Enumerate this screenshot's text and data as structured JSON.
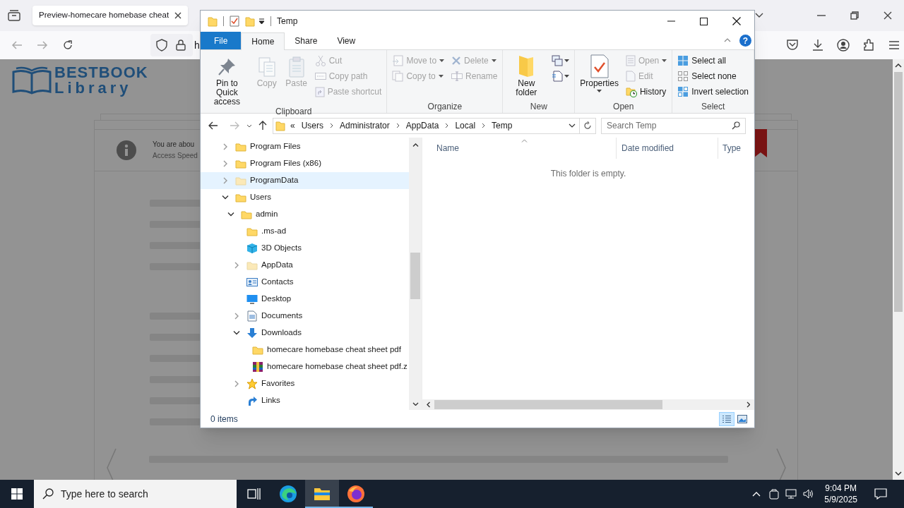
{
  "browser": {
    "tab": {
      "title": "Preview-homecare homebase cheat"
    },
    "url": "h"
  },
  "page": {
    "logo": {
      "line_1": "BESTBOOK",
      "line_2": "Library"
    },
    "notice": {
      "line_1": "You are abou",
      "line_2": "Access Speed"
    }
  },
  "explorer": {
    "title": "Temp",
    "help_label": "?",
    "ribbon_tabs": [
      {
        "label": "File",
        "kind": "file",
        "selected": false
      },
      {
        "label": "Home",
        "kind": "tab",
        "selected": true
      },
      {
        "label": "Share",
        "kind": "tab",
        "selected": false
      },
      {
        "label": "View",
        "kind": "tab",
        "selected": false
      }
    ],
    "ribbon_groups": [
      {
        "label": "Clipboard",
        "columns": [
          [
            {
              "label": "Pin to Quick access",
              "kind": "large",
              "disabled": false
            }
          ],
          [
            {
              "label": "Copy",
              "kind": "large",
              "disabled": true
            }
          ],
          [
            {
              "label": "Paste",
              "kind": "large",
              "disabled": true
            }
          ],
          [
            {
              "label": "Cut",
              "kind": "small",
              "disabled": true
            },
            {
              "label": "Copy path",
              "kind": "small",
              "disabled": true
            },
            {
              "label": "Paste shortcut",
              "kind": "small",
              "disabled": true
            }
          ]
        ]
      },
      {
        "label": "Organize",
        "columns": [
          [
            {
              "label": "Move to",
              "kind": "small",
              "disabled": true,
              "dropdown": true
            },
            {
              "label": "Copy to",
              "kind": "small",
              "disabled": true,
              "dropdown": true
            }
          ],
          [
            {
              "label": "Delete",
              "kind": "small",
              "disabled": true,
              "dropdown": true
            },
            {
              "label": "Rename",
              "kind": "small",
              "disabled": true
            }
          ]
        ]
      },
      {
        "label": "New",
        "columns": [
          [
            {
              "label": "New folder",
              "kind": "large",
              "disabled": false
            }
          ],
          [
            {
              "kind": "icon",
              "disabled": false,
              "dropdown": true
            },
            {
              "kind": "icon",
              "disabled": false,
              "dropdown": true
            }
          ]
        ]
      },
      {
        "label": "Open",
        "columns": [
          [
            {
              "label": "Properties",
              "kind": "large",
              "disabled": false,
              "dropdown": true
            }
          ],
          [
            {
              "label": "Open",
              "kind": "small",
              "disabled": true,
              "dropdown": true
            },
            {
              "label": "Edit",
              "kind": "small",
              "disabled": true
            },
            {
              "label": "History",
              "kind": "small",
              "disabled": false
            }
          ]
        ]
      },
      {
        "label": "Select",
        "columns": [
          [
            {
              "label": "Select all",
              "kind": "small",
              "disabled": false
            },
            {
              "label": "Select none",
              "kind": "small",
              "disabled": false
            },
            {
              "label": "Invert selection",
              "kind": "small",
              "disabled": false
            }
          ]
        ]
      }
    ],
    "address": {
      "overflow": "«",
      "segments": [
        "Users",
        "Administrator",
        "AppData",
        "Local",
        "Temp"
      ]
    },
    "search": {
      "placeholder": "Search Temp"
    },
    "tree": [
      {
        "label": "Program Files",
        "kind": "folder",
        "expanded": false,
        "selected": false
      },
      {
        "label": "Program Files (x86)",
        "kind": "folder",
        "expanded": false,
        "selected": false
      },
      {
        "label": "ProgramData",
        "kind": "hidden-folder",
        "expanded": false,
        "selected": true
      },
      {
        "label": "Users",
        "kind": "folder",
        "expanded": true,
        "selected": false,
        "children": [
          {
            "label": "admin",
            "kind": "folder",
            "expanded": true,
            "selected": false,
            "children": [
              {
                "label": ".ms-ad",
                "kind": "folder",
                "selected": false
              },
              {
                "label": "3D Objects",
                "kind": "objects",
                "selected": false
              },
              {
                "label": "AppData",
                "kind": "hidden-folder",
                "expanded": false,
                "selected": false
              },
              {
                "label": "Contacts",
                "kind": "contacts",
                "selected": false
              },
              {
                "label": "Desktop",
                "kind": "desktop",
                "selected": false
              },
              {
                "label": "Documents",
                "kind": "documents",
                "expanded": false,
                "selected": false
              },
              {
                "label": "Downloads",
                "kind": "downloads",
                "expanded": true,
                "selected": false,
                "children": [
                  {
                    "label": "homecare homebase cheat sheet pdf",
                    "kind": "folder",
                    "selected": false
                  },
                  {
                    "label": "homecare homebase cheat sheet pdf.z",
                    "kind": "archive",
                    "selected": false
                  }
                ]
              },
              {
                "label": "Favorites",
                "kind": "favorites",
                "expanded": false,
                "selected": false
              },
              {
                "label": "Links",
                "kind": "links",
                "selected": false
              }
            ]
          }
        ]
      }
    ],
    "columns": [
      {
        "label": "Name",
        "sorted": true
      },
      {
        "label": "Date modified",
        "sorted": false
      },
      {
        "label": "Type",
        "sorted": false
      }
    ],
    "empty_message": "This folder is empty.",
    "status": "0 items",
    "view_buttons": [
      {
        "kind": "details",
        "selected": true
      },
      {
        "kind": "large-icons",
        "selected": false
      }
    ]
  },
  "taskbar": {
    "search_placeholder": "Type here to search",
    "apps": [
      {
        "kind": "task-view",
        "running": false,
        "selected": false
      },
      {
        "kind": "edge",
        "running": false,
        "selected": false
      },
      {
        "kind": "explorer",
        "running": true,
        "selected": true
      },
      {
        "kind": "firefox",
        "running": true,
        "selected": false
      }
    ],
    "time": "9:04 PM",
    "date": "5/9/2025"
  }
}
